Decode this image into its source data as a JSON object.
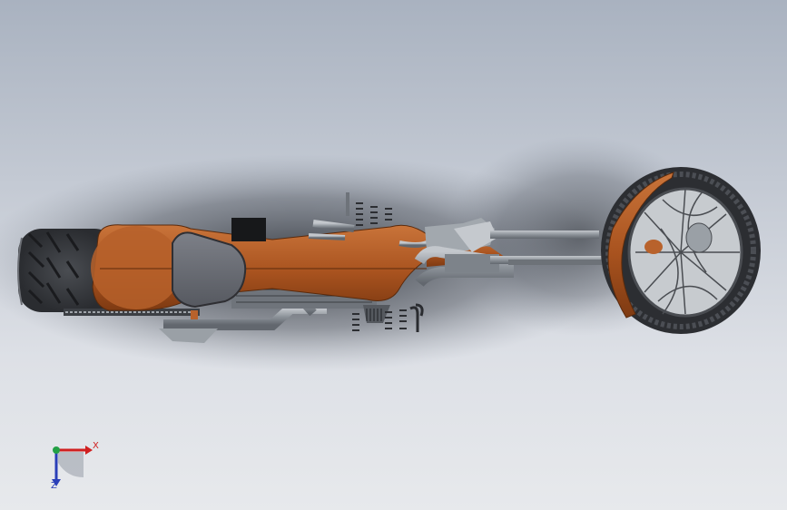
{
  "viewport": {
    "background_top": "#a9b2c0",
    "background_bottom": "#e7e9ec",
    "model": "motorcycle-top-view",
    "body_color": "#b8622c",
    "metal_color": "#8d939a",
    "tire_color": "#3b3d40"
  },
  "triad": {
    "x_label": "X",
    "z_label": "Z",
    "x_color": "#d02020",
    "y_color": "#22a045",
    "z_color": "#2a3fb8"
  }
}
